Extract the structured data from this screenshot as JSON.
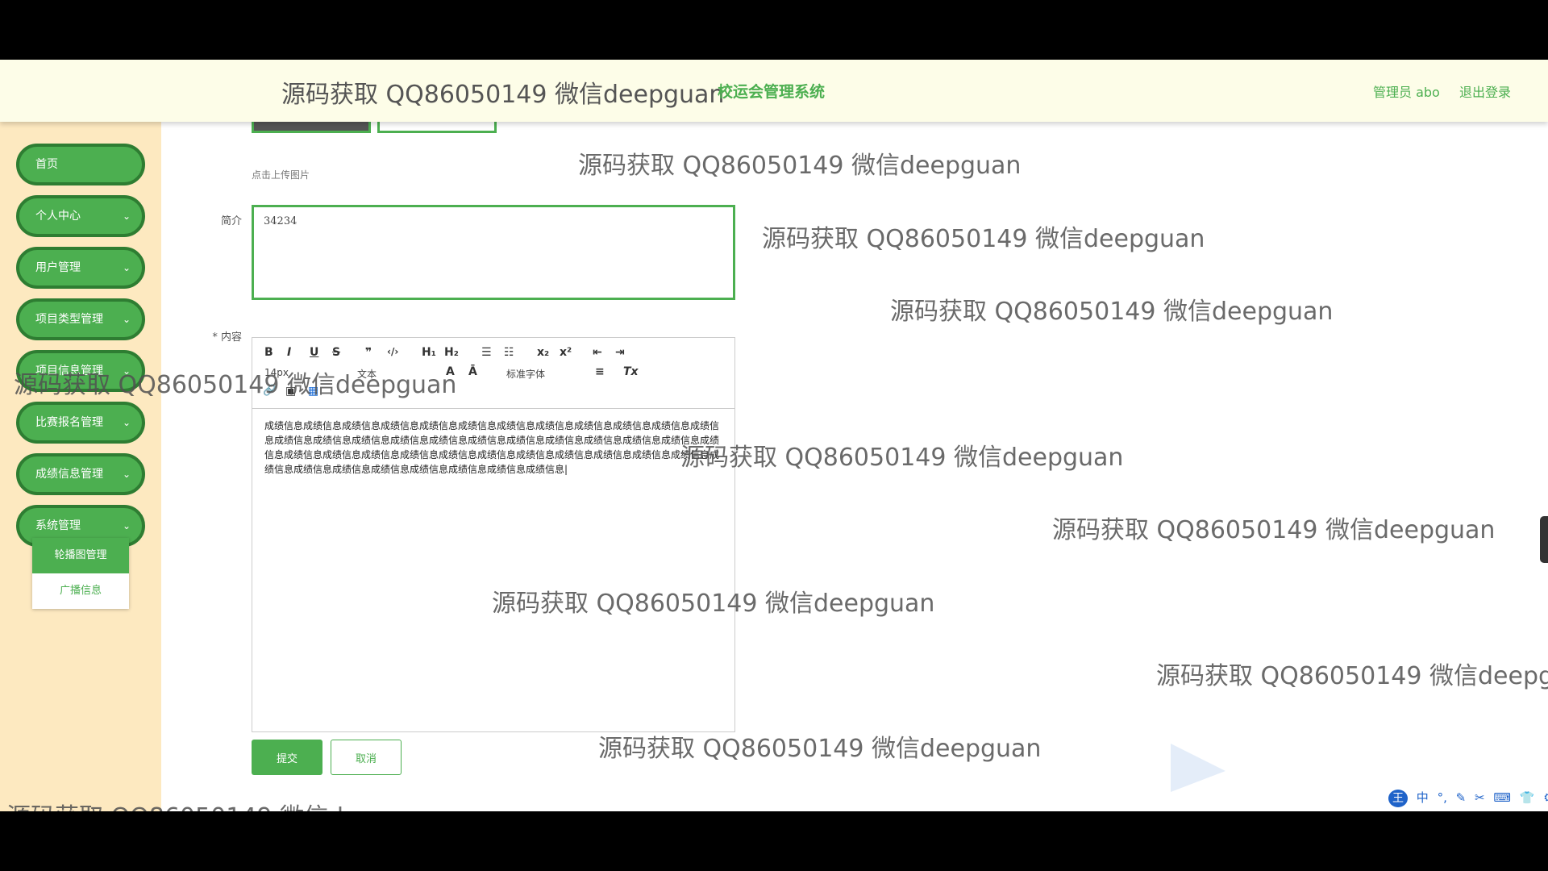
{
  "watermark": "源码获取 QQ86050149 微信deepguan",
  "header": {
    "watermark_title": "源码获取 QQ86050149 微信deepguan",
    "system_title": "校运会管理系统",
    "admin_label": "管理员 abo",
    "logout_label": "退出登录"
  },
  "sidebar": {
    "items": [
      {
        "label": "首页"
      },
      {
        "label": "个人中心"
      },
      {
        "label": "用户管理"
      },
      {
        "label": "项目类型管理"
      },
      {
        "label": "项目信息管理"
      },
      {
        "label": "比赛报名管理"
      },
      {
        "label": "成绩信息管理"
      },
      {
        "label": "系统管理"
      }
    ],
    "chevron": "⌄",
    "submenu": [
      {
        "label": "轮播图管理"
      },
      {
        "label": "广播信息"
      }
    ]
  },
  "form": {
    "upload_hint": "点击上传图片",
    "intro_label": "简介",
    "intro_value": "34234",
    "content_label": "* 内容",
    "content_text": "成绩信息成绩信息成绩信息成绩信息成绩信息成绩信息成绩信息成绩信息成绩信息成绩信息成绩信息成绩信息成绩信息成绩信息成绩信息成绩信息成绩信息成绩信息成绩信息成绩信息成绩信息成绩信息成绩信息成绩信息成绩信息成绩信息成绩信息成绩信息成绩信息成绩信息成绩信息成绩信息成绩信息成绩信息成绩信息成绩信息成绩信息成绩信息成绩信息成绩信息成绩信息成绩信息成绩信息|",
    "toolbar": {
      "bold": "B",
      "italic": "I",
      "underline": "U",
      "strike": "S",
      "quote": "❞",
      "code": "‹/›",
      "h1": "H₁",
      "h2": "H₂",
      "ol": "☰",
      "ul": "☷",
      "sub": "x₂",
      "sup": "x²",
      "outdent": "⇤",
      "indent": "⇥",
      "size_select": "14px",
      "text_select": "文本",
      "color": "A",
      "bg_color": "Ā",
      "font_select": "标准字体",
      "align": "≡",
      "clear": "Tx",
      "link": "🔗",
      "image": "▣",
      "video": "▦"
    },
    "submit_label": "提交",
    "cancel_label": "取消"
  },
  "ime": [
    "中",
    "°,",
    "✎",
    "✂",
    "⌨",
    "👕",
    "⚙"
  ]
}
